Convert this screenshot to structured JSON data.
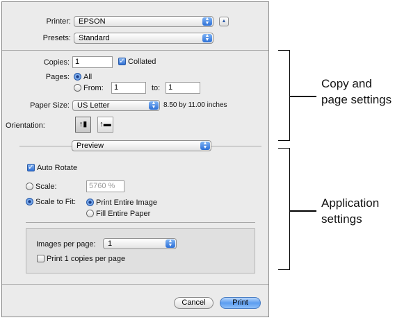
{
  "printer": {
    "label": "Printer:",
    "value": "EPSON"
  },
  "presets": {
    "label": "Presets:",
    "value": "Standard"
  },
  "copies": {
    "label": "Copies:",
    "value": "1",
    "collated_label": "Collated",
    "collated_checked": true
  },
  "pages": {
    "label": "Pages:",
    "all_label": "All",
    "from_label": "From:",
    "from_value": "1",
    "to_label": "to:",
    "to_value": "1"
  },
  "paper_size": {
    "label": "Paper Size:",
    "value": "US Letter",
    "dimensions": "8.50 by 11.00 inches"
  },
  "orientation": {
    "label": "Orientation:"
  },
  "panel_select": {
    "value": "Preview"
  },
  "auto_rotate": {
    "label": "Auto Rotate",
    "checked": true
  },
  "scale": {
    "label": "Scale:",
    "value": "5760 %"
  },
  "scale_to_fit": {
    "label": "Scale to Fit:",
    "print_entire_label": "Print Entire Image",
    "fill_entire_label": "Fill Entire Paper"
  },
  "images_per_page": {
    "label": "Images per page:",
    "value": "1"
  },
  "print_copies_per_page": {
    "label": "Print 1 copies per page",
    "checked": false
  },
  "buttons": {
    "cancel": "Cancel",
    "print": "Print"
  },
  "callouts": {
    "copy_page_line1": "Copy and",
    "copy_page_line2": "page settings",
    "application_line1": "Application",
    "application_line2": "settings"
  }
}
